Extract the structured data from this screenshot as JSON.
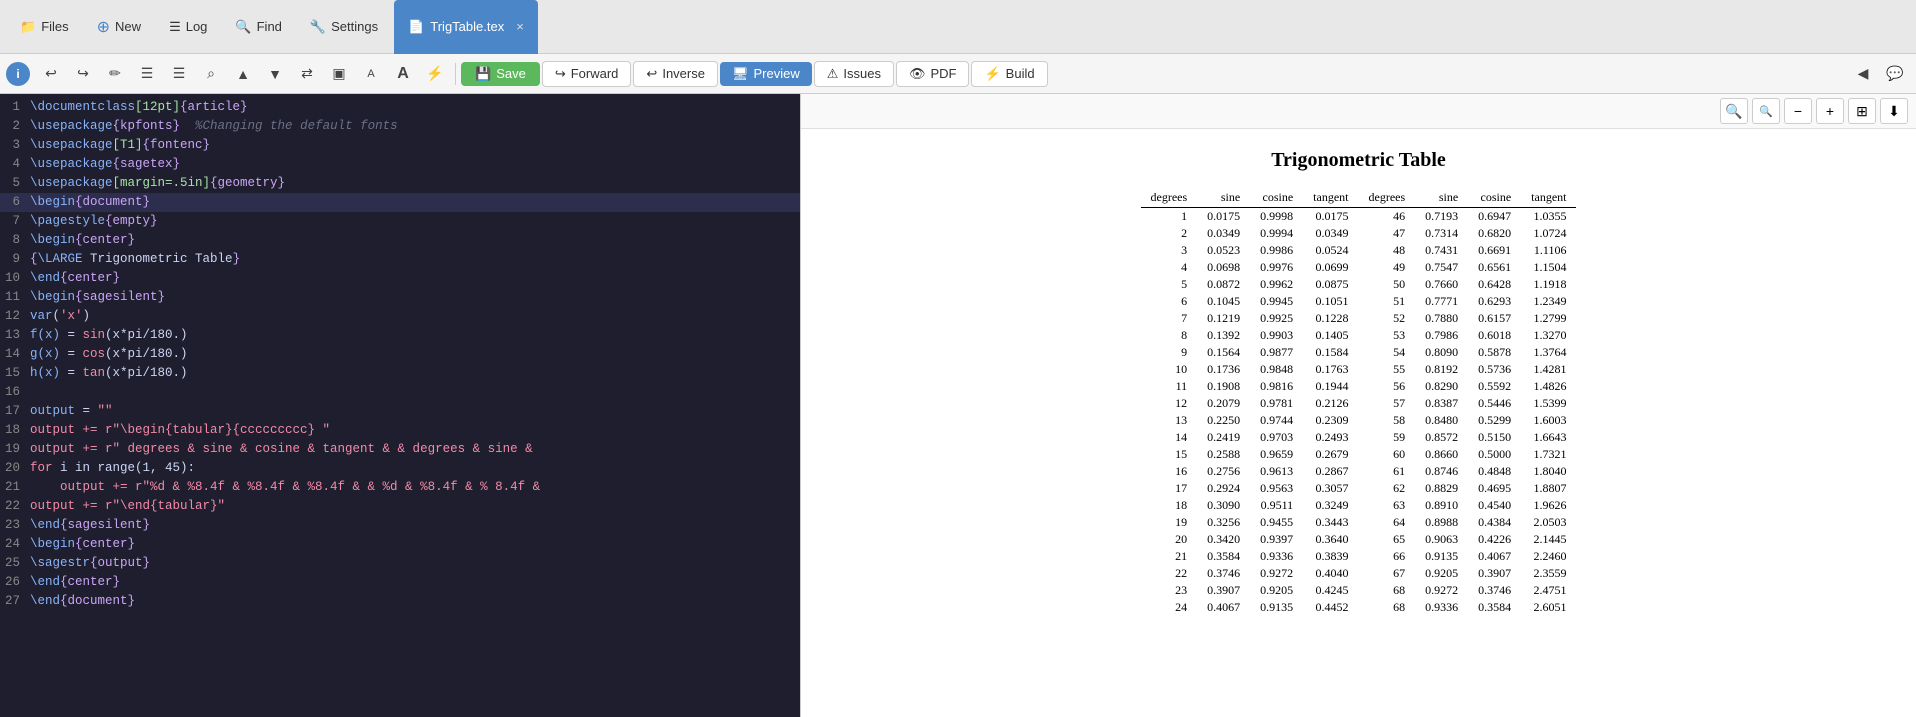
{
  "nav": {
    "files_label": "Files",
    "new_label": "New",
    "log_label": "Log",
    "find_label": "Find",
    "settings_label": "Settings",
    "tab_label": "TrigTable.tex",
    "tab_close": "×"
  },
  "toolbar": {
    "info_label": "i",
    "undo_label": "↩",
    "redo_label": "↪",
    "format_label": "✏",
    "list1_label": "☰",
    "list2_label": "☰",
    "search_label": "⌕",
    "up_label": "▲",
    "down_label": "▼",
    "arrows_label": "⇄",
    "split_label": "▣",
    "A_small": "A",
    "A_large": "A",
    "lightning": "⚡",
    "save_label": "Save",
    "forward_label": "Forward",
    "inverse_label": "Inverse",
    "preview_label": "Preview",
    "issues_label": "Issues",
    "pdf_label": "PDF",
    "build_label": "Build"
  },
  "preview": {
    "title": "Trigonometric Table",
    "zoom_in": "🔍",
    "zoom_out": "🔍",
    "zoom_minus": "−",
    "zoom_plus": "+",
    "grid": "⊞",
    "download": "⬇",
    "headers": [
      "degrees",
      "sine",
      "cosine",
      "tangent",
      "degrees",
      "sine",
      "cosine",
      "tangent"
    ],
    "rows": [
      [
        1,
        "0.0175",
        "0.9998",
        "0.0175",
        46,
        "0.7193",
        "0.6947",
        "1.0355"
      ],
      [
        2,
        "0.0349",
        "0.9994",
        "0.0349",
        47,
        "0.7314",
        "0.6820",
        "1.0724"
      ],
      [
        3,
        "0.0523",
        "0.9986",
        "0.0524",
        48,
        "0.7431",
        "0.6691",
        "1.1106"
      ],
      [
        4,
        "0.0698",
        "0.9976",
        "0.0699",
        49,
        "0.7547",
        "0.6561",
        "1.1504"
      ],
      [
        5,
        "0.0872",
        "0.9962",
        "0.0875",
        50,
        "0.7660",
        "0.6428",
        "1.1918"
      ],
      [
        6,
        "0.1045",
        "0.9945",
        "0.1051",
        51,
        "0.7771",
        "0.6293",
        "1.2349"
      ],
      [
        7,
        "0.1219",
        "0.9925",
        "0.1228",
        52,
        "0.7880",
        "0.6157",
        "1.2799"
      ],
      [
        8,
        "0.1392",
        "0.9903",
        "0.1405",
        53,
        "0.7986",
        "0.6018",
        "1.3270"
      ],
      [
        9,
        "0.1564",
        "0.9877",
        "0.1584",
        54,
        "0.8090",
        "0.5878",
        "1.3764"
      ],
      [
        10,
        "0.1736",
        "0.9848",
        "0.1763",
        55,
        "0.8192",
        "0.5736",
        "1.4281"
      ],
      [
        11,
        "0.1908",
        "0.9816",
        "0.1944",
        56,
        "0.8290",
        "0.5592",
        "1.4826"
      ],
      [
        12,
        "0.2079",
        "0.9781",
        "0.2126",
        57,
        "0.8387",
        "0.5446",
        "1.5399"
      ],
      [
        13,
        "0.2250",
        "0.9744",
        "0.2309",
        58,
        "0.8480",
        "0.5299",
        "1.6003"
      ],
      [
        14,
        "0.2419",
        "0.9703",
        "0.2493",
        59,
        "0.8572",
        "0.5150",
        "1.6643"
      ],
      [
        15,
        "0.2588",
        "0.9659",
        "0.2679",
        60,
        "0.8660",
        "0.5000",
        "1.7321"
      ],
      [
        16,
        "0.2756",
        "0.9613",
        "0.2867",
        61,
        "0.8746",
        "0.4848",
        "1.8040"
      ],
      [
        17,
        "0.2924",
        "0.9563",
        "0.3057",
        62,
        "0.8829",
        "0.4695",
        "1.8807"
      ],
      [
        18,
        "0.3090",
        "0.9511",
        "0.3249",
        63,
        "0.8910",
        "0.4540",
        "1.9626"
      ],
      [
        19,
        "0.3256",
        "0.9455",
        "0.3443",
        64,
        "0.8988",
        "0.4384",
        "2.0503"
      ],
      [
        20,
        "0.3420",
        "0.9397",
        "0.3640",
        65,
        "0.9063",
        "0.4226",
        "2.1445"
      ],
      [
        21,
        "0.3584",
        "0.9336",
        "0.3839",
        66,
        "0.9135",
        "0.4067",
        "2.2460"
      ],
      [
        22,
        "0.3746",
        "0.9272",
        "0.4040",
        67,
        "0.9205",
        "0.3907",
        "2.3559"
      ],
      [
        23,
        "0.3907",
        "0.9205",
        "0.4245",
        68,
        "0.9272",
        "0.3746",
        "2.4751"
      ],
      [
        24,
        "0.4067",
        "0.9135",
        "0.4452",
        68,
        "0.9336",
        "0.3584",
        "2.6051"
      ]
    ]
  },
  "editor": {
    "lines": [
      {
        "num": 1,
        "text": "\\documentclass[12pt]{article}"
      },
      {
        "num": 2,
        "text": "\\usepackage{kpfonts}  %Changing the default fonts"
      },
      {
        "num": 3,
        "text": "\\usepackage[T1]{fontenc}"
      },
      {
        "num": 4,
        "text": "\\usepackage{sagetex}"
      },
      {
        "num": 5,
        "text": "\\usepackage[margin=.5in]{geometry}"
      },
      {
        "num": 6,
        "text": "\\begin{document}"
      },
      {
        "num": 7,
        "text": "\\pagestyle{empty}"
      },
      {
        "num": 8,
        "text": "\\begin{center}"
      },
      {
        "num": 9,
        "text": "{\\LARGE Trigonometric Table}"
      },
      {
        "num": 10,
        "text": "\\end{center}"
      },
      {
        "num": 11,
        "text": "\\begin{sagesilent}"
      },
      {
        "num": 12,
        "text": "var('x')"
      },
      {
        "num": 13,
        "text": "f(x) = sin(x*pi/180.)"
      },
      {
        "num": 14,
        "text": "g(x) = cos(x*pi/180.)"
      },
      {
        "num": 15,
        "text": "h(x) = tan(x*pi/180.)"
      },
      {
        "num": 16,
        "text": ""
      },
      {
        "num": 17,
        "text": "output = \"\""
      },
      {
        "num": 18,
        "text": "output += r\"\\begin{tabular}{ccccccccc} \""
      },
      {
        "num": 19,
        "text": "output += r\" degrees & sine & cosine & tangent & & degrees & sine &"
      },
      {
        "num": 20,
        "text": "for i in range(1, 45):"
      },
      {
        "num": 21,
        "text": "    output += r\"%d & %8.4f & %8.4f & %8.4f & & %d & %8.4f & % 8.4f &"
      },
      {
        "num": 22,
        "text": "output += r\"\\end{tabular}\""
      },
      {
        "num": 23,
        "text": "\\end{sagesilent}"
      },
      {
        "num": 24,
        "text": "\\begin{center}"
      },
      {
        "num": 25,
        "text": "\\sagestr{output}"
      },
      {
        "num": 26,
        "text": "\\end{center}"
      },
      {
        "num": 27,
        "text": "\\end{document}"
      }
    ]
  }
}
